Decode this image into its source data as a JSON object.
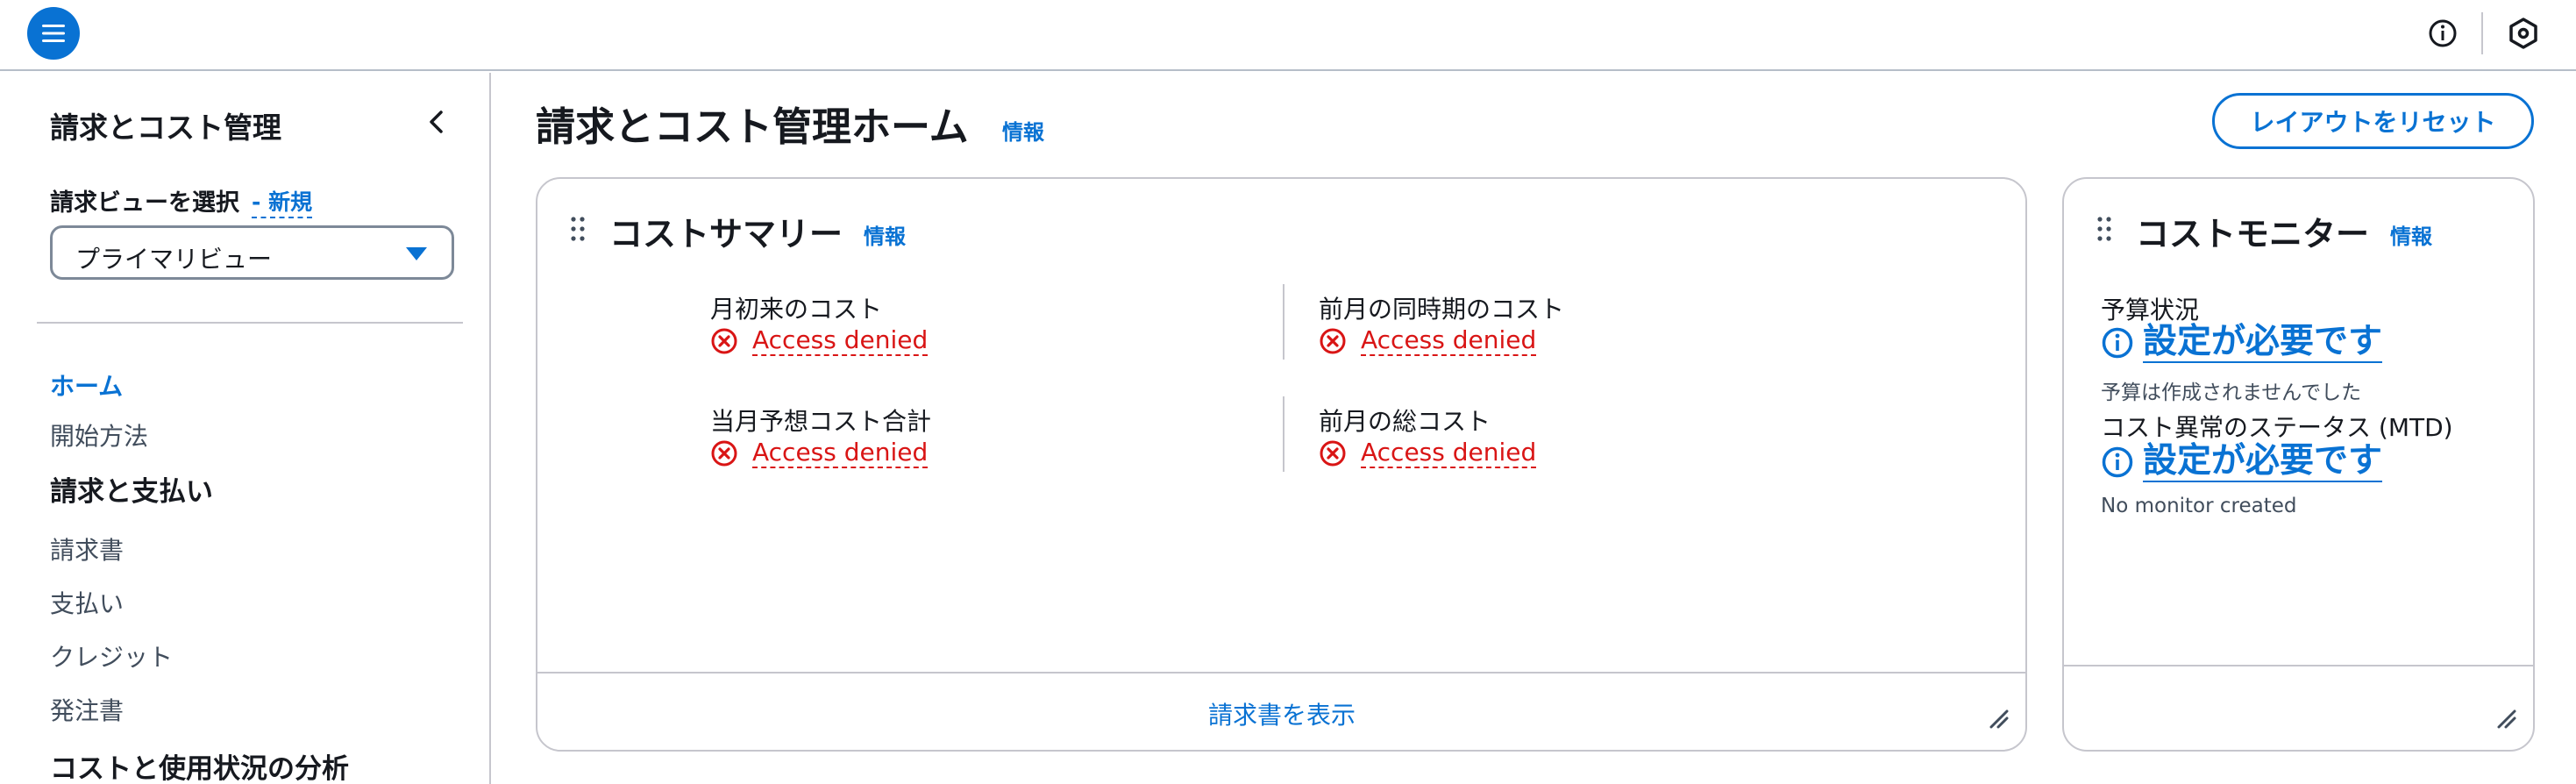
{
  "topbar": {
    "menu_icon": "hamburger-menu-icon",
    "info_icon": "info-circle-icon",
    "settings_icon": "hexagon-settings-icon"
  },
  "sidebar": {
    "title": "請求とコスト管理",
    "view_label": "請求ビューを選択",
    "view_new": "- 新規",
    "view_selected": "プライマリビュー",
    "nav_home": "ホーム",
    "nav_getting_started": "開始方法",
    "section_billing": "請求と支払い",
    "nav_invoices": "請求書",
    "nav_payments": "支払い",
    "nav_credits": "クレジット",
    "nav_purchase_orders": "発注書",
    "section_cost_analysis": "コストと使用状況の分析"
  },
  "main": {
    "page_title": "請求とコスト管理ホーム",
    "page_info": "情報",
    "reset_layout": "レイアウトをリセット"
  },
  "cost_summary": {
    "title": "コストサマリー",
    "info": "情報",
    "metrics": [
      {
        "label": "月初来のコスト",
        "status": "Access denied"
      },
      {
        "label": "前月の同時期のコスト",
        "status": "Access denied"
      },
      {
        "label": "当月予想コスト合計",
        "status": "Access denied"
      },
      {
        "label": "前月の総コスト",
        "status": "Access denied"
      }
    ],
    "footer_link": "請求書を表示"
  },
  "cost_monitor": {
    "title": "コストモニター",
    "info": "情報",
    "budget_label": "予算状況",
    "budget_status": "設定が必要です",
    "budget_note": "予算は作成されませんでした",
    "anomaly_label": "コスト異常のステータス (MTD)",
    "anomaly_status": "設定が必要です",
    "anomaly_note": "No monitor created"
  },
  "colors": {
    "accent": "#0972d3",
    "error": "#d91515",
    "border": "#c6c6cd",
    "text": "#16191f"
  }
}
